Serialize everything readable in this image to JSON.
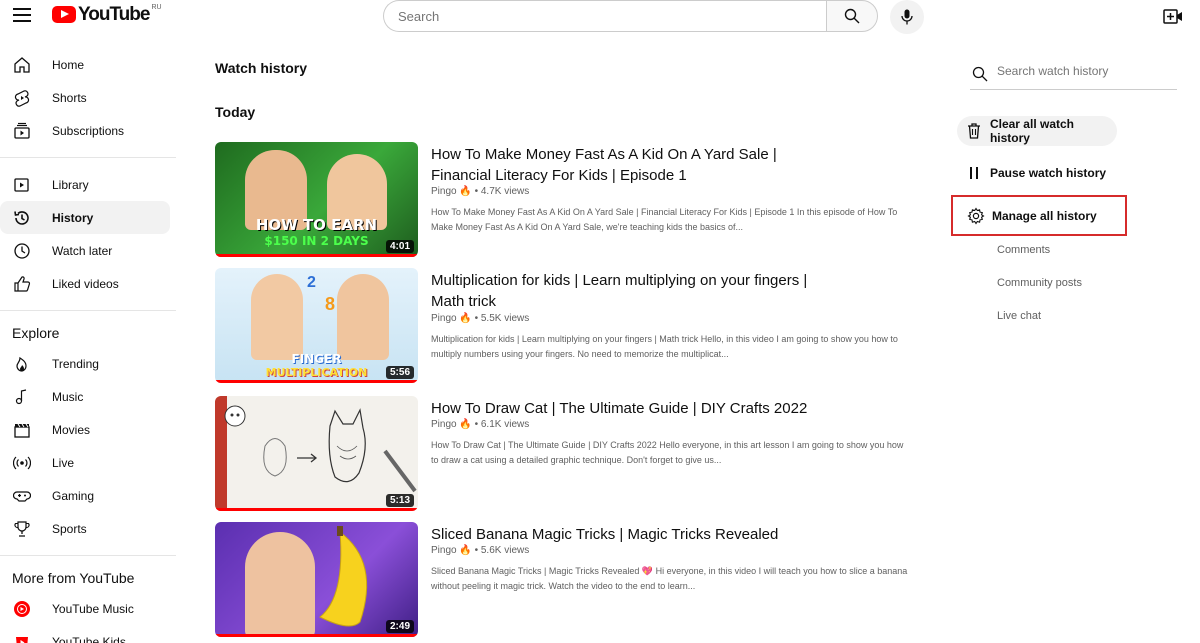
{
  "topbar": {
    "logo_text": "YouTube",
    "country_code": "RU",
    "search_placeholder": "Search"
  },
  "sidebar": {
    "main": [
      {
        "label": "Home",
        "icon": "home-icon"
      },
      {
        "label": "Shorts",
        "icon": "shorts-icon"
      },
      {
        "label": "Subscriptions",
        "icon": "subscriptions-icon"
      }
    ],
    "library": [
      {
        "label": "Library",
        "icon": "library-icon"
      },
      {
        "label": "History",
        "icon": "history-icon",
        "active": true
      },
      {
        "label": "Watch later",
        "icon": "clock-icon"
      },
      {
        "label": "Liked videos",
        "icon": "thumbs-up-icon"
      }
    ],
    "explore_heading": "Explore",
    "explore": [
      {
        "label": "Trending",
        "icon": "trending-icon"
      },
      {
        "label": "Music",
        "icon": "music-icon"
      },
      {
        "label": "Movies",
        "icon": "movies-icon"
      },
      {
        "label": "Live",
        "icon": "live-icon"
      },
      {
        "label": "Gaming",
        "icon": "gaming-icon"
      },
      {
        "label": "Sports",
        "icon": "trophy-icon"
      }
    ],
    "more_heading": "More from YouTube",
    "more": [
      {
        "label": "YouTube Music",
        "icon": "youtube-music-icon"
      },
      {
        "label": "YouTube Kids",
        "icon": "youtube-kids-icon"
      }
    ]
  },
  "main": {
    "page_title": "Watch history",
    "section_title": "Today",
    "videos": [
      {
        "title": "How To Make Money Fast As A Kid On A Yard Sale | Financial Literacy For Kids | Episode 1",
        "channel": "Pingo",
        "views": "4.7K views",
        "description": "How To Make Money Fast As A Kid On A Yard Sale | Financial Literacy For Kids | Episode 1 In this episode of How To Make Money Fast As A Kid On A Yard Sale, we're teaching kids the basics of...",
        "duration": "4:01",
        "thumb_text_1": "HOW TO EARN",
        "thumb_text_2": "$150 IN 2 DAYS",
        "thumb_color": "#2e8b2e"
      },
      {
        "title": "Multiplication for kids | Learn multiplying on your fingers | Math trick",
        "channel": "Pingo",
        "views": "5.5K views",
        "description": "Multiplication for kids | Learn multiplying on your fingers | Math trick Hello, in this video I am going to show you how to multiply numbers using your fingers. No need to memorize the multiplicat...",
        "duration": "5:56",
        "thumb_text_1": "FINGER",
        "thumb_text_2": "MULTIPLICATION",
        "thumb_color": "#d8ecf7"
      },
      {
        "title": "How To Draw Cat | The Ultimate Guide | DIY Crafts 2022",
        "channel": "Pingo",
        "views": "6.1K views",
        "description": "How To Draw Cat | The Ultimate Guide | DIY Crafts 2022 Hello everyone, in this art lesson I am going to show you how to draw a cat using a detailed graphic technique. Don't forget to give us...",
        "duration": "5:13",
        "thumb_color": "#f1efea"
      },
      {
        "title": "Sliced Banana Magic Tricks | Magic Tricks Revealed",
        "channel": "Pingo",
        "views": "5.6K views",
        "description": "Sliced Banana Magic Tricks | Magic Tricks Revealed 💖 Hi everyone, in this video I will teach you how to slice a banana without peeling it magic trick. Watch the video to the end to learn...",
        "duration": "2:49",
        "thumb_color": "#7a3fc7"
      }
    ]
  },
  "right_panel": {
    "search_placeholder": "Search watch history",
    "clear_label": "Clear all watch history",
    "pause_label": "Pause watch history",
    "manage_label": "Manage all history",
    "links": [
      "Comments",
      "Community posts",
      "Live chat"
    ]
  },
  "colors": {
    "brand_red": "#ff0000",
    "highlight_box": "#d62b2b",
    "meta_gray": "#606060"
  }
}
